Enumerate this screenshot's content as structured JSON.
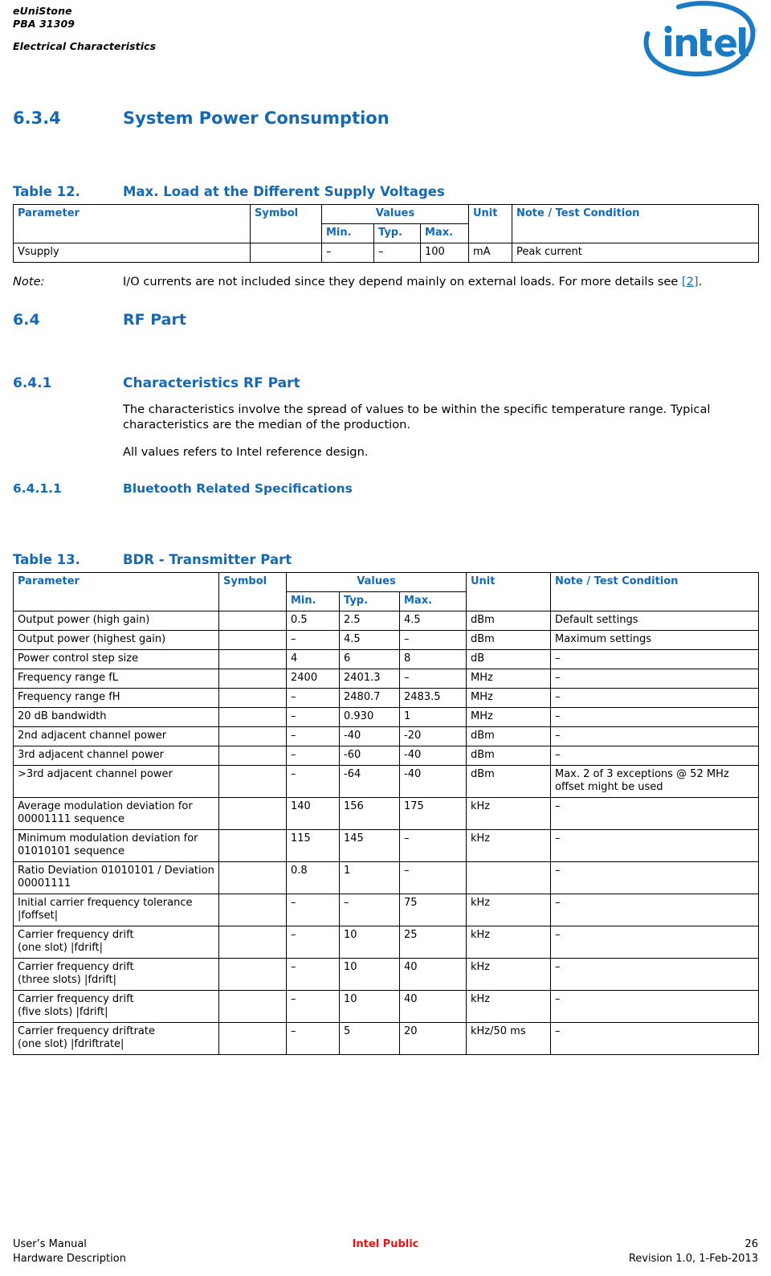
{
  "header": {
    "company": "eUniStone",
    "part": "PBA 31309",
    "chapter": "Electrical Characteristics",
    "logo_name": "intel-logo",
    "logo_wordmark": "intel",
    "logo_trademark": "®",
    "brand_blue": "#1569B4"
  },
  "sections": {
    "s634": {
      "number": "6.3.4",
      "title": "System Power Consumption"
    },
    "s64": {
      "number": "6.4",
      "title": "RF Part"
    },
    "s641": {
      "number": "6.4.1",
      "title": "Characteristics RF Part"
    },
    "s6411": {
      "number": "6.4.1.1",
      "title": "Bluetooth Related Specifications"
    }
  },
  "paragraphs": {
    "characteristics": "The characteristics involve the spread of values to be within the specific temperature range. Typical characteristics are the median of the production.",
    "reference_design": "All values refers to Intel reference design."
  },
  "note": {
    "label": "Note:",
    "text_before": "I/O currents are not included since they depend mainly on external loads. For more details see ",
    "link": "[2]",
    "text_after": "."
  },
  "table12": {
    "caption_number": "Table 12.",
    "caption_title": "Max. Load at the Different Supply Voltages",
    "headers": {
      "parameter": "Parameter",
      "symbol": "Symbol",
      "values": "Values",
      "unit": "Unit",
      "note": "Note / Test Condition",
      "min": "Min.",
      "typ": "Typ.",
      "max": "Max."
    },
    "rows": [
      {
        "parameter": "Vsupply",
        "symbol": "",
        "min": "–",
        "typ": "–",
        "max": "100",
        "unit": "mA",
        "note": "Peak current"
      }
    ]
  },
  "table13": {
    "caption_number": "Table 13.",
    "caption_title": "BDR - Transmitter Part",
    "headers": {
      "parameter": "Parameter",
      "symbol": "Symbol",
      "values": "Values",
      "unit": "Unit",
      "note": "Note / Test Condition",
      "min": "Min.",
      "typ": "Typ.",
      "max": "Max."
    },
    "rows": [
      {
        "parameter": "Output power (high gain)",
        "symbol": "",
        "min": "0.5",
        "typ": "2.5",
        "max": "4.5",
        "unit": "dBm",
        "note": "Default settings"
      },
      {
        "parameter": "Output power (highest gain)",
        "symbol": "",
        "min": "–",
        "typ": "4.5",
        "max": "–",
        "unit": "dBm",
        "note": "Maximum settings"
      },
      {
        "parameter": "Power control step size",
        "symbol": "",
        "min": "4",
        "typ": "6",
        "max": "8",
        "unit": "dB",
        "note": "–"
      },
      {
        "parameter": "Frequency range fL",
        "symbol": "",
        "min": "2400",
        "typ": "2401.3",
        "max": "–",
        "unit": "MHz",
        "note": "–"
      },
      {
        "parameter": "Frequency range fH",
        "symbol": "",
        "min": "–",
        "typ": "2480.7",
        "max": "2483.5",
        "unit": "MHz",
        "note": "–"
      },
      {
        "parameter": "20 dB bandwidth",
        "symbol": "",
        "min": "–",
        "typ": "0.930",
        "max": "1",
        "unit": "MHz",
        "note": "–"
      },
      {
        "parameter": "2nd adjacent channel power",
        "symbol": "",
        "min": "–",
        "typ": "-40",
        "max": "-20",
        "unit": "dBm",
        "note": "–"
      },
      {
        "parameter": "3rd adjacent channel power",
        "symbol": "",
        "min": "–",
        "typ": "-60",
        "max": "-40",
        "unit": "dBm",
        "note": "–"
      },
      {
        "parameter": ">3rd adjacent channel power",
        "symbol": "",
        "min": "–",
        "typ": "-64",
        "max": "-40",
        "unit": "dBm",
        "note": "Max. 2 of 3 exceptions @ 52 MHz offset might be used"
      },
      {
        "parameter": "Average modulation deviation for 00001111 sequence",
        "symbol": "",
        "min": "140",
        "typ": "156",
        "max": "175",
        "unit": "kHz",
        "note": "–"
      },
      {
        "parameter": "Minimum modulation deviation for 01010101 sequence",
        "symbol": "",
        "min": "115",
        "typ": "145",
        "max": "–",
        "unit": "kHz",
        "note": "–"
      },
      {
        "parameter": "Ratio Deviation 01010101 / Deviation 00001111",
        "symbol": "",
        "min": "0.8",
        "typ": "1",
        "max": "–",
        "unit": "",
        "note": "–"
      },
      {
        "parameter": "Initial carrier frequency tolerance |foffset|",
        "symbol": "",
        "min": "–",
        "typ": "–",
        "max": "75",
        "unit": "kHz",
        "note": "–"
      },
      {
        "parameter": "Carrier frequency drift\n(one slot) |fdrift|",
        "symbol": "",
        "min": "–",
        "typ": "10",
        "max": "25",
        "unit": "kHz",
        "note": "–"
      },
      {
        "parameter": "Carrier frequency drift\n(three slots) |fdrift|",
        "symbol": "",
        "min": "–",
        "typ": "10",
        "max": "40",
        "unit": "kHz",
        "note": "–"
      },
      {
        "parameter": "Carrier frequency drift\n(five slots) |fdrift|",
        "symbol": "",
        "min": "–",
        "typ": "10",
        "max": "40",
        "unit": "kHz",
        "note": "–"
      },
      {
        "parameter": "Carrier frequency driftrate\n(one slot) |fdriftrate|",
        "symbol": "",
        "min": "–",
        "typ": "5",
        "max": "20",
        "unit": "kHz/50 ms",
        "note": "–"
      }
    ]
  },
  "footer": {
    "left_top": "User’s Manual",
    "left_bottom": "Hardware Description",
    "center_top": "Intel Public",
    "center_bottom": "",
    "right_top": "26",
    "right_bottom": "Revision 1.0, 1-Feb-2013",
    "center_color": "#EE1111"
  }
}
